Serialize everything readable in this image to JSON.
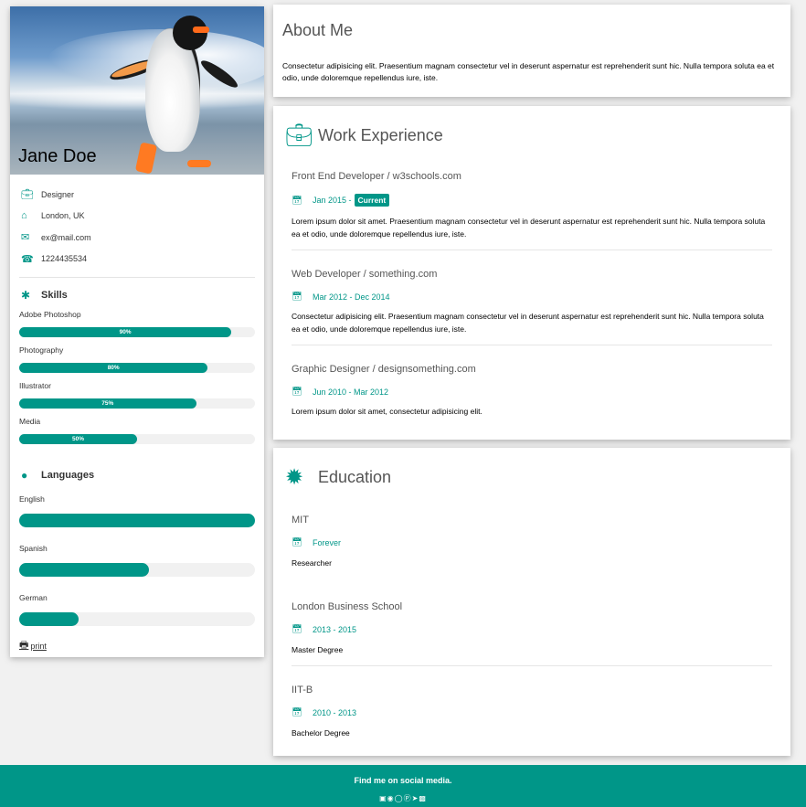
{
  "profile": {
    "name": "Jane Doe",
    "info": [
      {
        "icon": "briefcase-icon",
        "text": "Designer"
      },
      {
        "icon": "home-icon",
        "text": "London, UK"
      },
      {
        "icon": "envelope-icon",
        "text": "ex@mail.com"
      },
      {
        "icon": "phone-icon",
        "text": "1224435534"
      }
    ],
    "skills_title": "Skills",
    "skills": [
      {
        "label": "Adobe Photoshop",
        "percent": 90,
        "text": "90%"
      },
      {
        "label": "Photography",
        "percent": 80,
        "text": "80%"
      },
      {
        "label": "Illustrator",
        "percent": 75,
        "text": "75%"
      },
      {
        "label": "Media",
        "percent": 50,
        "text": "50%"
      }
    ],
    "languages_title": "Languages",
    "languages": [
      {
        "label": "English",
        "percent": 100
      },
      {
        "label": "Spanish",
        "percent": 55
      },
      {
        "label": "German",
        "percent": 25
      }
    ],
    "print_label": "print"
  },
  "about": {
    "title": "About Me",
    "text": "Consectetur adipisicing elit. Praesentium magnam consectetur vel in deserunt aspernatur est reprehenderit sunt hic. Nulla tempora soluta ea et odio, unde doloremque repellendus iure, iste."
  },
  "work": {
    "title": "Work Experience",
    "entries": [
      {
        "title": "Front End Developer / w3schools.com",
        "date": "Jan 2015 - ",
        "badge": "Current",
        "text": "Lorem ipsum dolor sit amet. Praesentium magnam consectetur vel in deserunt aspernatur est reprehenderit sunt hic. Nulla tempora soluta ea et odio, unde doloremque repellendus iure, iste."
      },
      {
        "title": "Web Developer / something.com",
        "date": "Mar 2012 - Dec 2014",
        "text": "Consectetur adipisicing elit. Praesentium magnam consectetur vel in deserunt aspernatur est reprehenderit sunt hic. Nulla tempora soluta ea et odio, unde doloremque repellendus iure, iste."
      },
      {
        "title": "Graphic Designer / designsomething.com",
        "date": "Jun 2010 - Mar 2012",
        "text": "Lorem ipsum dolor sit amet, consectetur adipisicing elit."
      }
    ]
  },
  "education": {
    "title": "Education",
    "entries": [
      {
        "title": "MIT",
        "date": "Forever",
        "text": "Researcher"
      },
      {
        "title": "London Business School",
        "date": "2013 - 2015",
        "text": "Master Degree"
      },
      {
        "title": "IIT-B",
        "date": "2010 - 2013",
        "text": "Bachelor Degree"
      }
    ]
  },
  "footer": {
    "text": "Find me on social media.",
    "icons": [
      "facebook-icon",
      "instagram-icon",
      "snapchat-icon",
      "pinterest-icon",
      "twitter-icon",
      "linkedin-icon"
    ]
  },
  "colors": {
    "accent": "#009688",
    "background": "#f1f1f1"
  }
}
